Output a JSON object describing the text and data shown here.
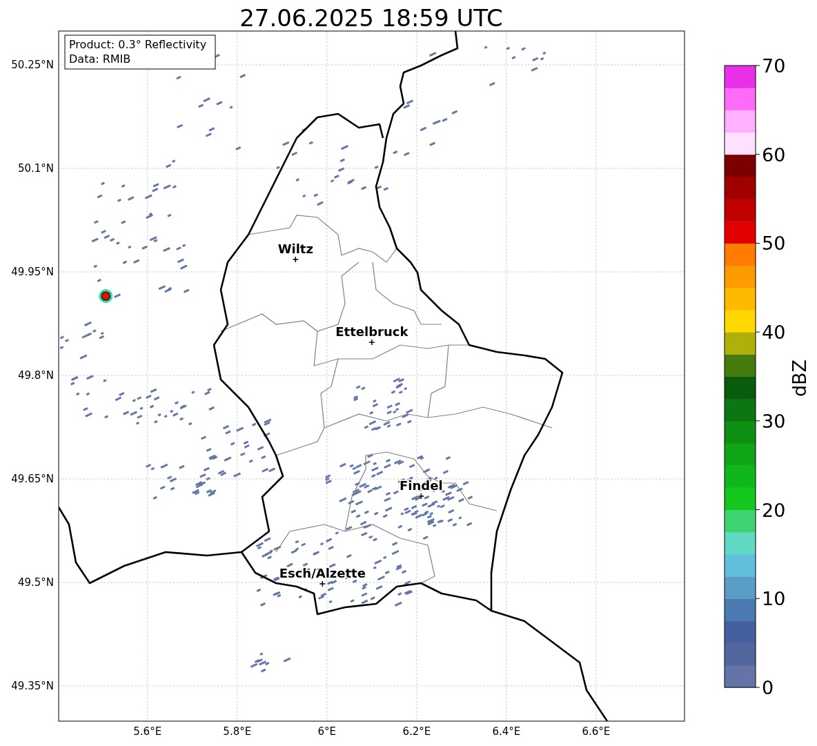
{
  "title": "27.06.2025 18:59 UTC",
  "info_box": [
    "Product: 0.3° Reflectivity",
    "Data: RMIB"
  ],
  "map": {
    "lat_ticks": [
      "50.25°N",
      "50.1°N",
      "49.95°N",
      "49.8°N",
      "49.65°N",
      "49.5°N",
      "49.35°N"
    ],
    "lon_ticks": [
      "5.6°E",
      "5.8°E",
      "6°E",
      "6.2°E",
      "6.4°E",
      "6.6°E"
    ],
    "cities": [
      "Wiltz",
      "Ettelbruck",
      "Findel",
      "Esch/Alzette"
    ]
  },
  "colorbar": {
    "label": "dBZ",
    "ticks": [
      "70",
      "60",
      "50",
      "40",
      "30",
      "20",
      "10",
      "0"
    ]
  }
}
